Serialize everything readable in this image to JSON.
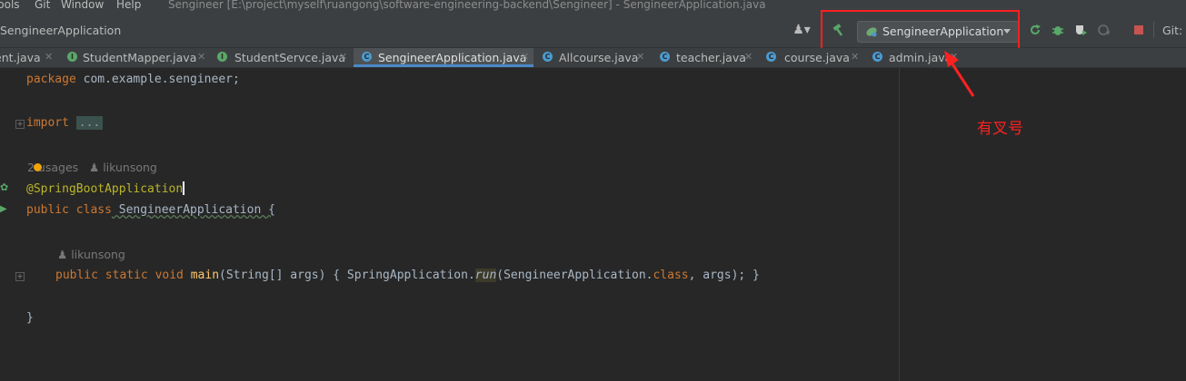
{
  "menu": {
    "items": [
      "Tools",
      "Git",
      "Window",
      "Help"
    ],
    "window_title": "Sengineer [E:\\project\\myself\\ruangong\\software-engineering-backend\\Sengineer] - SengineerApplication.java"
  },
  "navbar": {
    "breadcrumb": "SengineerApplication",
    "run_config": "SengineerApplication",
    "git_label": "Git:"
  },
  "tabs": [
    {
      "label": "ent.java",
      "icon": "I",
      "color": "#59a869"
    },
    {
      "label": "StudentMapper.java",
      "icon": "I",
      "color": "#59a869"
    },
    {
      "label": "StudentServce.java",
      "icon": "I",
      "color": "#59a869"
    },
    {
      "label": "SengineerApplication.java",
      "icon": "C",
      "color": "#4a9bd0",
      "active": true
    },
    {
      "label": "Allcourse.java",
      "icon": "C",
      "color": "#4a9bd0"
    },
    {
      "label": "teacher.java",
      "icon": "C",
      "color": "#4a9bd0"
    },
    {
      "label": "course.java",
      "icon": "C",
      "color": "#4a9bd0"
    },
    {
      "label": "admin.java",
      "icon": "C",
      "color": "#4a9bd0"
    }
  ],
  "code": {
    "package_kw": "package",
    "package_name": " com.example.sengineer;",
    "import_kw": "import",
    "import_folded": "...",
    "usages_hint": "2 usages",
    "author_hint_1": "likunsong",
    "annotation": "@SpringBootApplication",
    "class_kw": "public class",
    "class_name": " SengineerApplication {",
    "author_hint_2": "likunsong",
    "method_kw": "public static void",
    "method_name": " main",
    "method_args": "(String[] args) { SpringApplication.",
    "run_call": "run",
    "run_args_a": "(SengineerApplication.",
    "class_literal": "class",
    "run_args_b": ", args); }",
    "closing_brace": "}"
  },
  "annotation_note": "有叉号",
  "colors": {
    "highlight": "#ff1f1f",
    "accent": "#4a88c7"
  }
}
